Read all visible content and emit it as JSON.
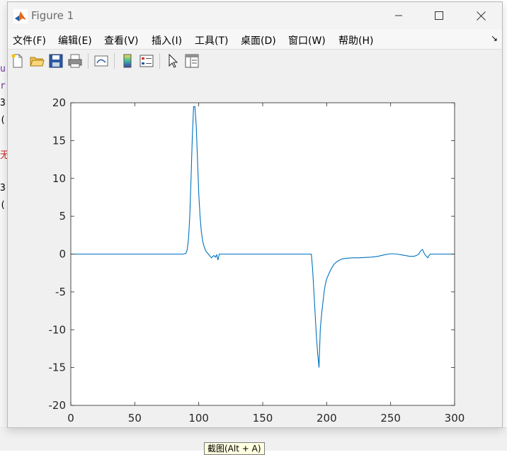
{
  "window": {
    "title": "Figure 1"
  },
  "menu": {
    "items": [
      "文件(F)",
      "编辑(E)",
      "查看(V)",
      "插入(I)",
      "工具(T)",
      "桌面(D)",
      "窗口(W)",
      "帮助(H)"
    ]
  },
  "toolbar": {
    "buttons": [
      "new-figure-icon",
      "open-file-icon",
      "save-icon",
      "print-icon",
      "link-plot-icon",
      "insert-colorbar-icon",
      "insert-legend-icon",
      "edit-plot-pointer-icon",
      "property-inspector-icon"
    ]
  },
  "background": {
    "tooltip": "截图(Alt + A)"
  },
  "colors": {
    "line": "#0072bd",
    "axes_bg": "#ffffff",
    "figure_bg": "#f0f0f0"
  },
  "chart_data": {
    "type": "line",
    "title": "",
    "xlabel": "",
    "ylabel": "",
    "xlim": [
      0,
      300
    ],
    "ylim": [
      -20,
      20
    ],
    "xticks": [
      0,
      50,
      100,
      150,
      200,
      250,
      300
    ],
    "yticks": [
      20,
      15,
      10,
      5,
      0,
      -5,
      -10,
      -15,
      -20
    ],
    "grid": false,
    "series": [
      {
        "x": [
          0,
          88,
          90,
          91,
          92,
          93,
          94,
          95,
          96,
          97,
          98,
          99,
          100,
          101,
          102,
          103,
          104,
          105,
          106,
          107,
          108,
          109,
          110,
          111,
          112,
          113,
          114,
          115,
          116,
          117,
          118,
          120,
          150,
          188,
          189,
          190,
          191,
          192,
          193,
          194,
          195,
          196,
          197,
          198,
          199,
          200,
          202,
          204,
          206,
          208,
          210,
          213,
          216,
          220,
          225,
          230,
          235,
          240,
          245,
          250,
          255,
          260,
          265,
          268,
          270,
          272,
          273,
          274,
          275,
          276,
          277,
          278,
          279,
          280,
          281,
          282,
          290,
          300
        ],
        "y": [
          0,
          0,
          0.1,
          0.6,
          2.0,
          5.0,
          10.0,
          15.5,
          19.5,
          19.5,
          17.0,
          12.5,
          8.0,
          5.0,
          3.0,
          1.8,
          1.1,
          0.6,
          0.3,
          0.1,
          -0.1,
          -0.3,
          -0.5,
          -0.3,
          -0.2,
          -0.4,
          -0.1,
          -0.8,
          0,
          0,
          0,
          0,
          0,
          0,
          -2.0,
          -5.0,
          -8.0,
          -11.0,
          -13.2,
          -15.0,
          -10.0,
          -8.0,
          -6.5,
          -5.0,
          -4.0,
          -3.3,
          -2.5,
          -1.8,
          -1.3,
          -1.0,
          -0.8,
          -0.6,
          -0.55,
          -0.5,
          -0.5,
          -0.45,
          -0.4,
          -0.3,
          -0.1,
          0.05,
          0.0,
          -0.15,
          -0.3,
          -0.3,
          -0.2,
          0.0,
          0.3,
          0.5,
          0.6,
          0.2,
          -0.1,
          -0.3,
          -0.5,
          -0.2,
          0.0,
          0.0,
          0.0,
          0.0
        ]
      }
    ]
  }
}
